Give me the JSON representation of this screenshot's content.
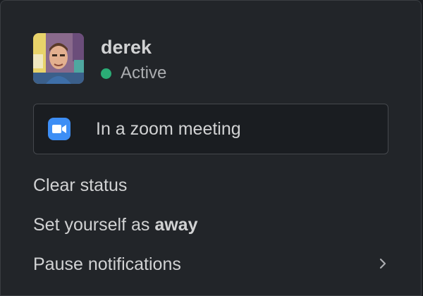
{
  "profile": {
    "username": "derek",
    "presence": "Active",
    "presence_color": "#2bac76"
  },
  "status": {
    "icon": "zoom-video-icon",
    "icon_color": "#3d8ef5",
    "text": "In a zoom meeting"
  },
  "menu": {
    "clear_status": "Clear status",
    "set_away_prefix": "Set yourself as ",
    "set_away_emphasis": "away",
    "pause_notifications": "Pause notifications",
    "pause_notifications_icon": "chevron-right-icon"
  }
}
